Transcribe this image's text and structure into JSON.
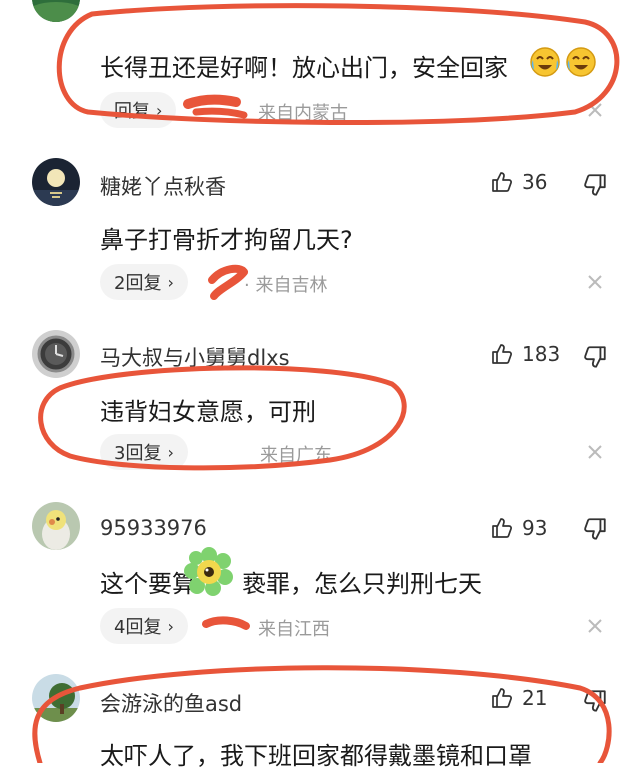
{
  "comments": [
    {
      "name": "",
      "text": "长得丑还是好啊！放心出门，安全回家",
      "reply_label": "回复",
      "meta": "来自内蒙古",
      "likes": "",
      "avatar_icon": "landscape-avatar-icon"
    },
    {
      "name": "糖姥丫点秋香",
      "text": "鼻子打骨折才拘留几天?",
      "reply_label": "2回复",
      "meta": "· 来自吉林",
      "likes": "36",
      "avatar_icon": "moon-avatar-icon"
    },
    {
      "name": "马大叔与小舅舅dlxs",
      "text": "违背妇女意愿，可刑",
      "reply_label": "3回复",
      "meta": "来自广东",
      "likes": "183",
      "avatar_icon": "watch-avatar-icon"
    },
    {
      "name": "95933976",
      "text_a": "这个要算",
      "text_b": "亵罪，怎么只判刑七天",
      "reply_label": "4回复",
      "meta": "来自江西",
      "likes": "93",
      "avatar_icon": "bird-avatar-icon"
    },
    {
      "name": "会游泳的鱼asd",
      "text": "太吓人了，我下班回家都得戴墨镜和口罩",
      "likes": "21",
      "avatar_icon": "tree-avatar-icon"
    }
  ],
  "annotation_color": "#e8553a",
  "emoji_icons": [
    "crying-laughing-emoji-icon",
    "crying-laughing-emoji-icon"
  ]
}
